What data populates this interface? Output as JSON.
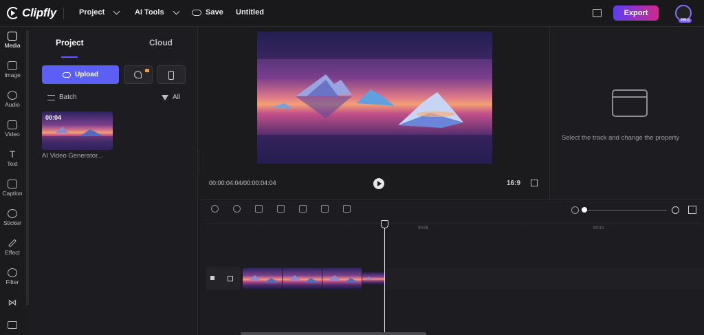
{
  "topbar": {
    "logo_text": "Clipfly",
    "menu": [
      {
        "label": "Project"
      },
      {
        "label": "AI Tools"
      },
      {
        "label": "Save"
      },
      {
        "label": "Untitled"
      }
    ],
    "export_label": "Export",
    "pro_badge": "PRO"
  },
  "rail": {
    "items": [
      {
        "label": "Media",
        "icon": "media-icon"
      },
      {
        "label": "Image",
        "icon": "image-icon"
      },
      {
        "label": "Audio",
        "icon": "audio-icon"
      },
      {
        "label": "Video",
        "icon": "video-icon"
      },
      {
        "label": "Text",
        "icon": "text-icon"
      },
      {
        "label": "Caption",
        "icon": "caption-icon"
      },
      {
        "label": "Sticker",
        "icon": "sticker-icon"
      },
      {
        "label": "Effect",
        "icon": "effect-icon"
      },
      {
        "label": "Filter",
        "icon": "filter-icon"
      }
    ]
  },
  "panel": {
    "tabs": [
      {
        "label": "Project"
      },
      {
        "label": "Cloud"
      }
    ],
    "upload_label": "Upload",
    "batch_label": "Batch",
    "filter_label": "All",
    "media": [
      {
        "duration": "00:04",
        "name": "AI Video Generator..."
      }
    ]
  },
  "preview": {
    "timecode": "00:00:04:04/00:00:04:04",
    "aspect_ratio": "16:9"
  },
  "properties": {
    "hint": "Select the track and change the property"
  },
  "timeline": {
    "ruler_labels": [
      "00:05",
      "00:10"
    ]
  },
  "colors": {
    "accent": "#5b5ff6",
    "export_gradient_start": "#5b3df5",
    "export_gradient_end": "#d02a8a"
  }
}
